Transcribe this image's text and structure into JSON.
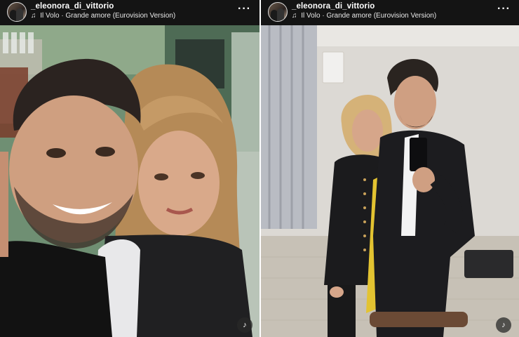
{
  "stories": [
    {
      "username": "_eleonora_di_vittorio",
      "music_note_icon": "music-note-icon",
      "music_artist": "Il Volo",
      "music_separator": "·",
      "music_title": "Grande amore (Eurovision Version)",
      "more_label": "···"
    },
    {
      "username": "_eleonora_di_vittorio",
      "music_note_icon": "music-note-icon",
      "music_artist": "Il Volo",
      "music_separator": "·",
      "music_title": "Grande amore (Eurovision Version)",
      "more_label": "···"
    }
  ],
  "icons": {
    "avatar": "avatar",
    "more": "more-options-icon",
    "mute": "sound-muted-icon"
  }
}
